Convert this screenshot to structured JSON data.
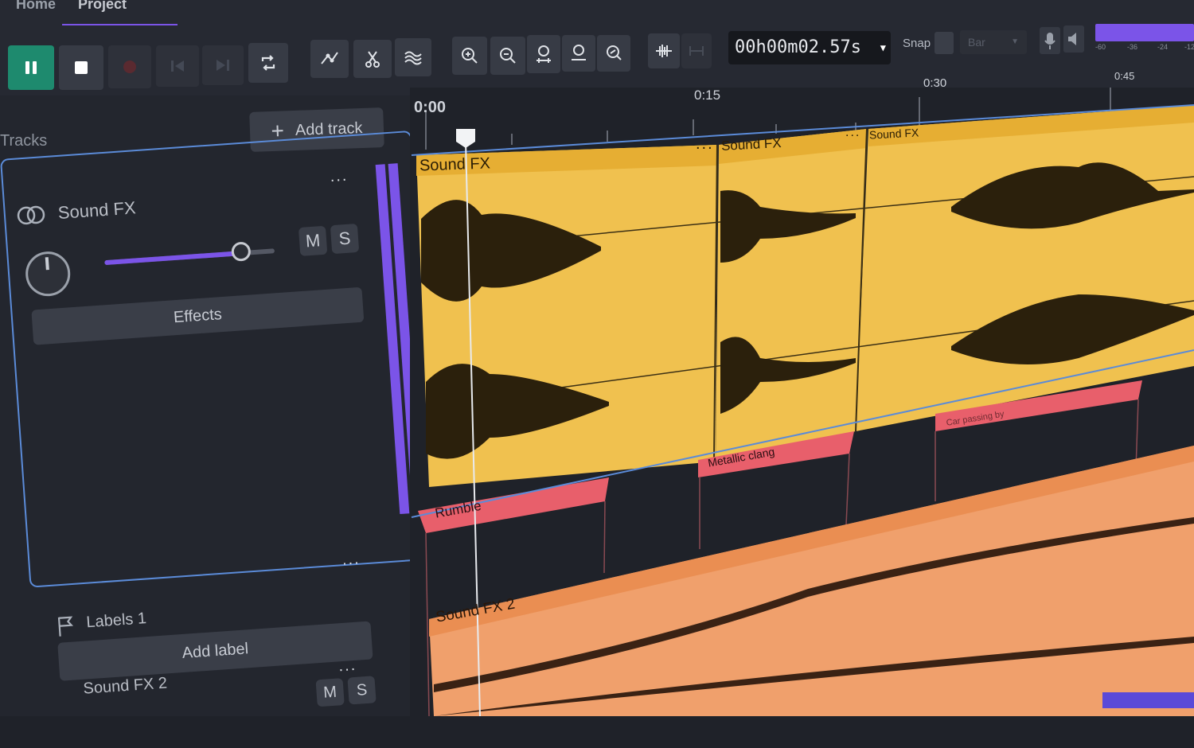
{
  "tabs": [
    "Home",
    "Project"
  ],
  "active_tab": 1,
  "toolbar": {
    "timecode": "00h00m02.57s",
    "snap_label": "Snap",
    "snap_value": "Bar"
  },
  "ruler": {
    "ticks": [
      "0:00",
      "0:15",
      "0:30",
      "0:45"
    ],
    "meter_ticks": [
      "-60",
      "-36",
      "-24",
      "-12"
    ]
  },
  "left": {
    "tracks_label": "Tracks",
    "add_track": "Add track",
    "track1": {
      "name": "Sound FX",
      "effects": "Effects",
      "mute": "M",
      "solo": "S",
      "menu": "..."
    },
    "labels_track": {
      "name": "Labels 1",
      "add_label": "Add label",
      "menu": "..."
    },
    "track2": {
      "name": "Sound FX 2",
      "mute": "M",
      "solo": "S",
      "menu": "..."
    }
  },
  "clips": {
    "clip1": {
      "name": "Sound FX",
      "menu": "..."
    },
    "clip2": {
      "name": "Sound FX",
      "menu": "..."
    },
    "clip3": {
      "name": "Sound FX",
      "menu": "..."
    },
    "clip4": {
      "name": "Sound FX 2"
    }
  },
  "labels": {
    "l1": "Rumble",
    "l2": "Metallic clang",
    "l3": "Car passing by"
  },
  "colors": {
    "accent": "#7b54e8",
    "play": "#1e8a6e",
    "clip_yellow": "#f0c14f",
    "clip_orange": "#f0a06c",
    "label_red": "#e85f6b",
    "selection": "#5b8bd8"
  }
}
